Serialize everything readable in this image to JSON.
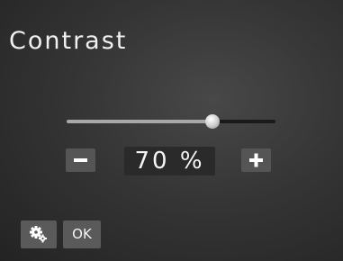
{
  "screen": {
    "title": "Contrast"
  },
  "slider": {
    "value_percent": 70
  },
  "controls": {
    "value_display": "70 %",
    "decrease_icon": "minus-icon",
    "increase_icon": "plus-icon"
  },
  "footer": {
    "settings_icon": "gears-icon",
    "ok_label": "OK"
  },
  "colors": {
    "background": "#353535",
    "button": "#555555",
    "slider_fill": "#a8a8a8",
    "text": "#f2f2f2"
  }
}
